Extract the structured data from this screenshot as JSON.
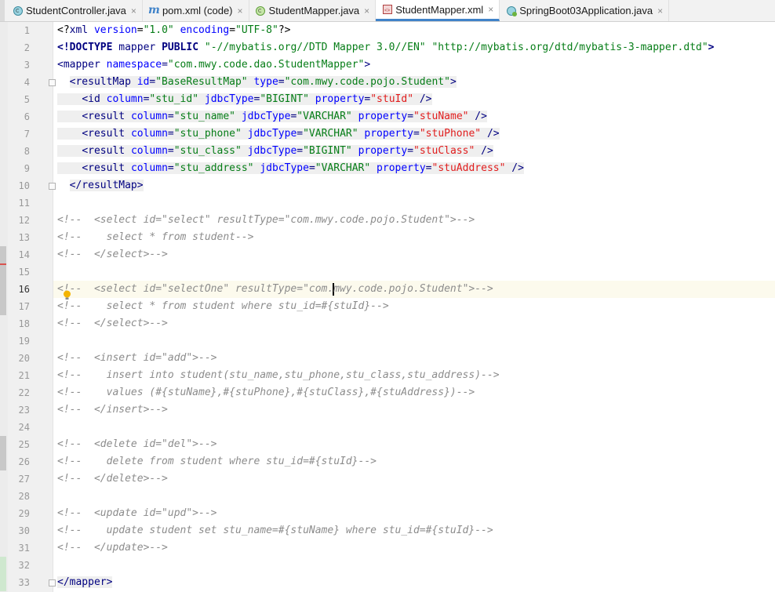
{
  "tabs": [
    {
      "label": "StudentController.java",
      "icon": "java-class-icon",
      "active": false
    },
    {
      "label": "pom.xml (code)",
      "icon": "maven-m-icon",
      "active": false
    },
    {
      "label": "StudentMapper.java",
      "icon": "java-interface-icon",
      "active": false
    },
    {
      "label": "StudentMapper.xml",
      "icon": "xml-file-icon",
      "active": true
    },
    {
      "label": "SpringBoot03Application.java",
      "icon": "spring-boot-class-icon",
      "active": false
    }
  ],
  "close_glyph": "×",
  "current_line": 16,
  "colors": {
    "tag": "#000080",
    "attribute": "#0000ff",
    "string": "#067d17",
    "property_value": "#e11d1d",
    "comment": "#8c8c8c",
    "active_tab_underline": "#4083c9",
    "current_line_bg": "#fcfaed"
  },
  "code_lines": [
    {
      "n": "1",
      "tokens": [
        [
          "pi",
          "<?"
        ],
        [
          "tag",
          "xml"
        ],
        [
          "pi",
          " "
        ],
        [
          "attr",
          "version"
        ],
        [
          "pi",
          "="
        ],
        [
          "str",
          "\"1.0\""
        ],
        [
          "pi",
          " "
        ],
        [
          "attr",
          "encoding"
        ],
        [
          "pi",
          "="
        ],
        [
          "str",
          "\"UTF-8\""
        ],
        [
          "pi",
          "?>"
        ]
      ]
    },
    {
      "n": "2",
      "tokens": [
        [
          "dt",
          "<!DOCTYPE "
        ],
        [
          "tag",
          "mapper "
        ],
        [
          "dt",
          "PUBLIC "
        ],
        [
          "str",
          "\"-//mybatis.org//DTD Mapper 3.0//EN\""
        ],
        [
          "pi",
          " "
        ],
        [
          "str",
          "\"http://mybatis.org/dtd/mybatis-3-mapper.dtd\""
        ],
        [
          "dt",
          ">"
        ]
      ]
    },
    {
      "n": "3",
      "tokens": [
        [
          "tag",
          "<mapper "
        ],
        [
          "attr",
          "namespace"
        ],
        [
          "tag",
          "="
        ],
        [
          "str",
          "\"com.mwy.code.dao.StudentMapper\""
        ],
        [
          "tag",
          ">"
        ]
      ]
    },
    {
      "n": "4",
      "tokens": [
        [
          "pi",
          "  "
        ],
        [
          "tagbg",
          "<resultMap "
        ],
        [
          "attrbg",
          "id"
        ],
        [
          "tagbg",
          "="
        ],
        [
          "strbg",
          "\"BaseResultMap\""
        ],
        [
          "tagbg",
          " "
        ],
        [
          "attrbg",
          "type"
        ],
        [
          "tagbg",
          "="
        ],
        [
          "strbg",
          "\"com.mwy.code.pojo.Student\""
        ],
        [
          "tagbg",
          ">"
        ]
      ]
    },
    {
      "n": "5",
      "tokens": [
        [
          "pibg",
          "    "
        ],
        [
          "tagbg",
          "<id "
        ],
        [
          "attrbg",
          "column"
        ],
        [
          "tagbg",
          "="
        ],
        [
          "strbg",
          "\"stu_id\""
        ],
        [
          "tagbg",
          " "
        ],
        [
          "attrbg",
          "jdbcType"
        ],
        [
          "tagbg",
          "="
        ],
        [
          "strbg",
          "\"BIGINT\""
        ],
        [
          "tagbg",
          " "
        ],
        [
          "attrbg",
          "property"
        ],
        [
          "tagbg",
          "="
        ],
        [
          "redbg",
          "\"stuId\""
        ],
        [
          "tagbg",
          " />"
        ]
      ]
    },
    {
      "n": "6",
      "tokens": [
        [
          "pibg",
          "    "
        ],
        [
          "tagbg",
          "<result "
        ],
        [
          "attrbg",
          "column"
        ],
        [
          "tagbg",
          "="
        ],
        [
          "strbg",
          "\"stu_name\""
        ],
        [
          "tagbg",
          " "
        ],
        [
          "attrbg",
          "jdbcType"
        ],
        [
          "tagbg",
          "="
        ],
        [
          "strbg",
          "\"VARCHAR\""
        ],
        [
          "tagbg",
          " "
        ],
        [
          "attrbg",
          "property"
        ],
        [
          "tagbg",
          "="
        ],
        [
          "redbg",
          "\"stuName\""
        ],
        [
          "tagbg",
          " />"
        ]
      ]
    },
    {
      "n": "7",
      "tokens": [
        [
          "pibg",
          "    "
        ],
        [
          "tagbg",
          "<result "
        ],
        [
          "attrbg",
          "column"
        ],
        [
          "tagbg",
          "="
        ],
        [
          "strbg",
          "\"stu_phone\""
        ],
        [
          "tagbg",
          " "
        ],
        [
          "attrbg",
          "jdbcType"
        ],
        [
          "tagbg",
          "="
        ],
        [
          "strbg",
          "\"VARCHAR\""
        ],
        [
          "tagbg",
          " "
        ],
        [
          "attrbg",
          "property"
        ],
        [
          "tagbg",
          "="
        ],
        [
          "redbg",
          "\"stuPhone\""
        ],
        [
          "tagbg",
          " />"
        ]
      ]
    },
    {
      "n": "8",
      "tokens": [
        [
          "pibg",
          "    "
        ],
        [
          "tagbg",
          "<result "
        ],
        [
          "attrbg",
          "column"
        ],
        [
          "tagbg",
          "="
        ],
        [
          "strbg",
          "\"stu_class\""
        ],
        [
          "tagbg",
          " "
        ],
        [
          "attrbg",
          "jdbcType"
        ],
        [
          "tagbg",
          "="
        ],
        [
          "strbg",
          "\"BIGINT\""
        ],
        [
          "tagbg",
          " "
        ],
        [
          "attrbg",
          "property"
        ],
        [
          "tagbg",
          "="
        ],
        [
          "redbg",
          "\"stuClass\""
        ],
        [
          "tagbg",
          " />"
        ]
      ]
    },
    {
      "n": "9",
      "tokens": [
        [
          "pibg",
          "    "
        ],
        [
          "tagbg",
          "<result "
        ],
        [
          "attrbg",
          "column"
        ],
        [
          "tagbg",
          "="
        ],
        [
          "strbg",
          "\"stu_address\""
        ],
        [
          "tagbg",
          " "
        ],
        [
          "attrbg",
          "jdbcType"
        ],
        [
          "tagbg",
          "="
        ],
        [
          "strbg",
          "\"VARCHAR\""
        ],
        [
          "tagbg",
          " "
        ],
        [
          "attrbg",
          "property"
        ],
        [
          "tagbg",
          "="
        ],
        [
          "redbg",
          "\"stuAddress\""
        ],
        [
          "tagbg",
          " />"
        ]
      ]
    },
    {
      "n": "10",
      "tokens": [
        [
          "pi",
          "  "
        ],
        [
          "tagbg",
          "</resultMap>"
        ]
      ]
    },
    {
      "n": "11",
      "tokens": []
    },
    {
      "n": "12",
      "tokens": [
        [
          "com",
          "<!--  <select id=\"select\" resultType=\"com.mwy.code.pojo.Student\">-->"
        ]
      ]
    },
    {
      "n": "13",
      "tokens": [
        [
          "com",
          "<!--    select * from student-->"
        ]
      ]
    },
    {
      "n": "14",
      "tokens": [
        [
          "com",
          "<!--  </select>-->"
        ]
      ]
    },
    {
      "n": "15",
      "tokens": []
    },
    {
      "n": "16",
      "tokens": [
        [
          "com",
          "<!--  <select id=\"selectOne\" resultType=\"com."
        ],
        [
          "caret",
          ""
        ],
        [
          "com",
          "mwy.code.pojo.Student\">-->"
        ]
      ]
    },
    {
      "n": "17",
      "tokens": [
        [
          "com",
          "<!--    select * from student where stu_id=#{stuId}-->"
        ]
      ]
    },
    {
      "n": "18",
      "tokens": [
        [
          "com",
          "<!--  </select>-->"
        ]
      ]
    },
    {
      "n": "19",
      "tokens": []
    },
    {
      "n": "20",
      "tokens": [
        [
          "com",
          "<!--  <insert id=\"add\">-->"
        ]
      ]
    },
    {
      "n": "21",
      "tokens": [
        [
          "com",
          "<!--    insert into student(stu_name,stu_phone,stu_class,stu_address)-->"
        ]
      ]
    },
    {
      "n": "22",
      "tokens": [
        [
          "com",
          "<!--    values (#{stuName},#{stuPhone},#{stuClass},#{stuAddress})-->"
        ]
      ]
    },
    {
      "n": "23",
      "tokens": [
        [
          "com",
          "<!--  </insert>-->"
        ]
      ]
    },
    {
      "n": "24",
      "tokens": []
    },
    {
      "n": "25",
      "tokens": [
        [
          "com",
          "<!--  <delete id=\"del\">-->"
        ]
      ]
    },
    {
      "n": "26",
      "tokens": [
        [
          "com",
          "<!--    delete from student where stu_id=#{stuId}-->"
        ]
      ]
    },
    {
      "n": "27",
      "tokens": [
        [
          "com",
          "<!--  </delete>-->"
        ]
      ]
    },
    {
      "n": "28",
      "tokens": []
    },
    {
      "n": "29",
      "tokens": [
        [
          "com",
          "<!--  <update id=\"upd\">-->"
        ]
      ]
    },
    {
      "n": "30",
      "tokens": [
        [
          "com",
          "<!--    update student set stu_name=#{stuName} where stu_id=#{stuId}-->"
        ]
      ]
    },
    {
      "n": "31",
      "tokens": [
        [
          "com",
          "<!--  </update>-->"
        ]
      ]
    },
    {
      "n": "32",
      "tokens": []
    },
    {
      "n": "33",
      "tokens": [
        [
          "tagbg",
          "</mapper>"
        ]
      ]
    }
  ]
}
